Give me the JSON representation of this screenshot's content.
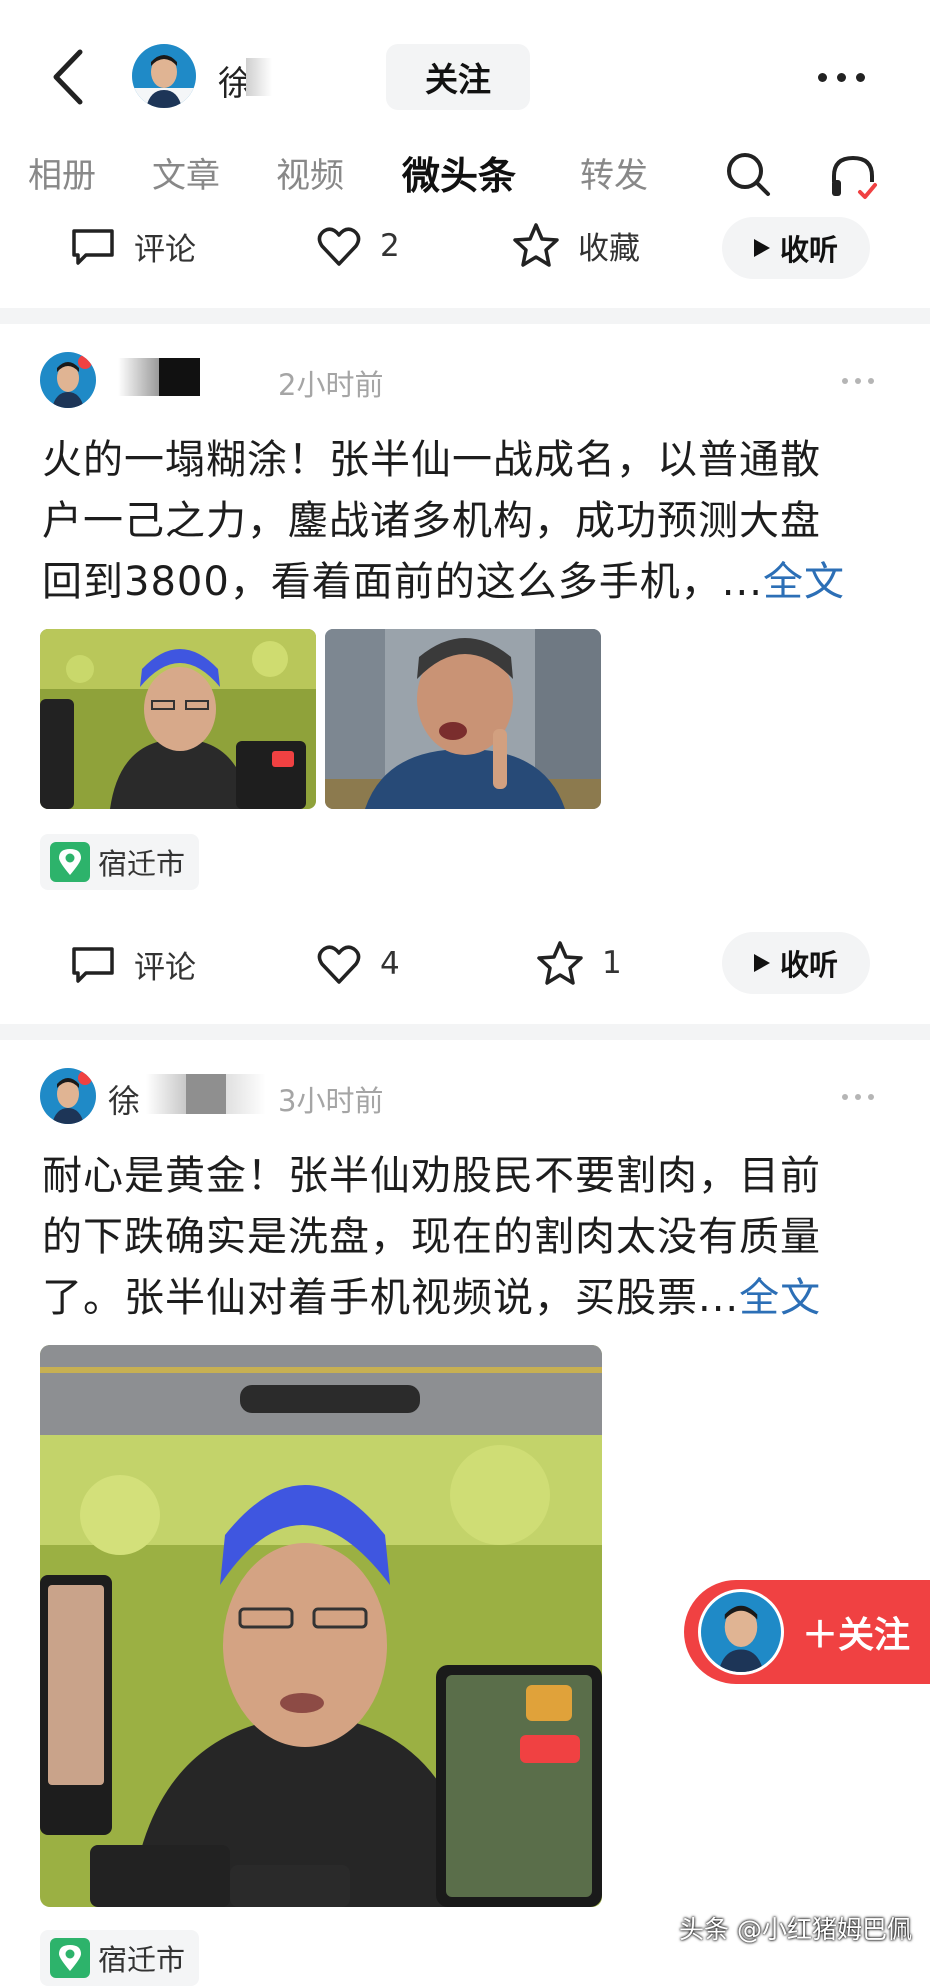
{
  "header": {
    "back_icon": "chevron-left-icon",
    "profile_name": "徐s",
    "follow_label": "关注",
    "more_icon": "more-horizontal-icon"
  },
  "tabs": [
    {
      "label": "相册"
    },
    {
      "label": "文章"
    },
    {
      "label": "视频"
    },
    {
      "label": "微头条",
      "active": true
    },
    {
      "label": "转发"
    }
  ],
  "toolbar_icons": [
    "search-icon",
    "headset-icon"
  ],
  "top_action_bar": {
    "comment_label": "评论",
    "like_count": "2",
    "collect_label": "收藏",
    "listen_label": "收听"
  },
  "posts": [
    {
      "time": "2小时前",
      "text": "火的一塌糊涂！张半仙一战成名，以普通散户一己之力，鏖战诸多机构，成功预测大盘回到3800，看着面前的这么多手机，...",
      "lines": [
        "火的一塌糊涂！张半仙一战成名，以普通散",
        "户一己之力，鏖战诸多机构，成功预测大盘",
        "回到3800，看着面前的这么多手机，..."
      ],
      "more_link": "全文",
      "location": "宿迁市",
      "comment_label": "评论",
      "like_count": "4",
      "collect_count": "1",
      "listen_label": "收听"
    },
    {
      "author_prefix": "徐",
      "time": "3小时前",
      "lines": [
        "耐心是黄金！张半仙劝股民不要割肉，目前",
        "的下跌确实是洗盘，现在的割肉太没有质量",
        "了。张半仙对着手机视频说，买股票..."
      ],
      "more_link": "全文",
      "location": "宿迁市"
    }
  ],
  "floating_follow": {
    "label": "＋关注"
  },
  "watermark": "头条 @小红猪姆巴佩",
  "colors": {
    "accent_red": "#f04142",
    "link_blue": "#2c6fb6",
    "location_green": "#2db36b"
  }
}
